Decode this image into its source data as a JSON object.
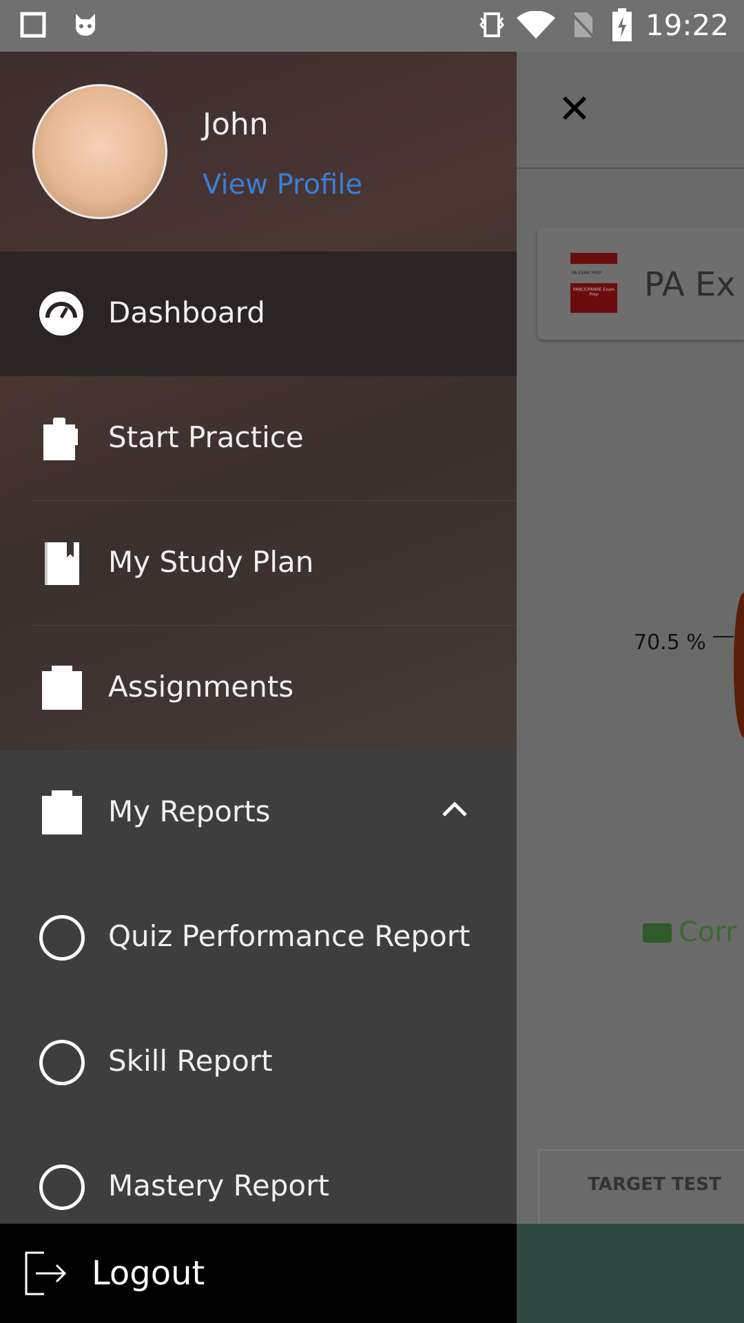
{
  "status_bar": {
    "time": "19:22",
    "icons": [
      "square-icon",
      "cat-icon",
      "vibrate-icon",
      "wifi-icon",
      "no-sim-icon",
      "battery-charging-icon"
    ]
  },
  "drawer": {
    "user": {
      "name": "John",
      "view_profile": "View Profile"
    },
    "items": [
      {
        "label": "Dashboard",
        "icon": "dashboard-gauge-icon",
        "active": true
      },
      {
        "label": "Start Practice",
        "icon": "clipboard-hand-icon"
      },
      {
        "label": "My Study Plan",
        "icon": "book-icon"
      },
      {
        "label": "Assignments",
        "icon": "clipboard-icon"
      },
      {
        "label": "My Reports",
        "icon": "clipboard-icon",
        "expanded": true
      }
    ],
    "sub_items": [
      {
        "label": "Quiz Performance Report"
      },
      {
        "label": "Skill Report"
      },
      {
        "label": "Mastery Report"
      }
    ],
    "logout": "Logout"
  },
  "background": {
    "card_title": "PA Ex",
    "logo": {
      "top": "PA EXAM PREP",
      "bottom": "PANCE/PANRE Exam Prep"
    },
    "pie_label": "70.5 %",
    "legend": "Corr",
    "target_button": "TARGET TEST",
    "colors": {
      "pie": "#5a1d08",
      "legend": "#2f5a2a",
      "bottom_bar": "#304a43",
      "link": "#3b7dd8"
    }
  }
}
